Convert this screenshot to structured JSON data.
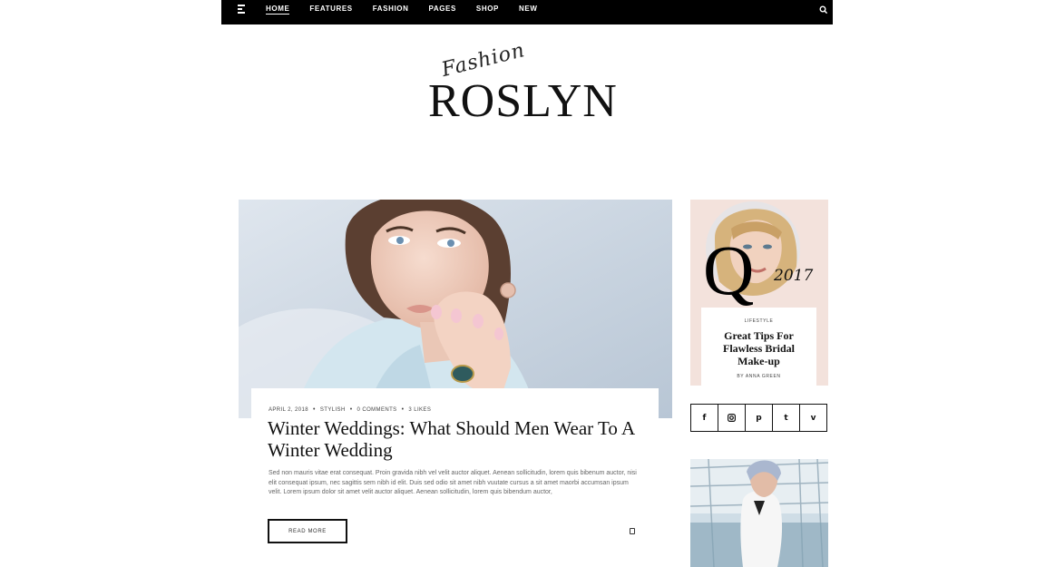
{
  "nav": {
    "items": [
      {
        "label": "HOME",
        "active": true
      },
      {
        "label": "FEATURES",
        "active": false
      },
      {
        "label": "FASHION",
        "active": false
      },
      {
        "label": "PAGES",
        "active": false
      },
      {
        "label": "SHOP",
        "active": false
      },
      {
        "label": "NEW",
        "active": false
      }
    ],
    "menu_icon": "hamburger-icon",
    "search_icon": "search-icon"
  },
  "logo": {
    "script": "Fashion",
    "main": "ROSLYN"
  },
  "feature": {
    "date": "APRIL 2, 2018",
    "category": "STYLISH",
    "comments": "0 COMMENTS",
    "likes": "3 LIKES",
    "title": "Winter Weddings: What Should Men Wear To A Winter Wedding",
    "excerpt": "Sed non mauris vitae erat consequat. Proin gravida nibh vel velit auctor aliquet. Aenean sollicitudin, lorem quis bibenum auctor, nisi elit consequat ipsum, nec sagittis sem nibh id elit. Duis sed odio sit amet nibh vuutate cursus a sit amet maorbi accumsan ipsum velit. Lorem ipsum dolor sit amet velit auctor aliquet. Aenean sollicitudin, lorem quis bibendum auctor,",
    "read_more": "READ MORE",
    "share_icon": "share-icon"
  },
  "promo": {
    "letter": "Q",
    "year": "2017",
    "category": "LIFESTYLE",
    "title": "Great Tips For Flawless Bridal Make-up",
    "author": "BY ANNA GREEN"
  },
  "social": [
    {
      "icon": "facebook-icon",
      "glyph": "f"
    },
    {
      "icon": "instagram-icon",
      "glyph": "◘"
    },
    {
      "icon": "pinterest-icon",
      "glyph": "p"
    },
    {
      "icon": "twitter-icon",
      "glyph": "t"
    },
    {
      "icon": "vimeo-icon",
      "glyph": "v"
    }
  ],
  "colors": {
    "nav_bg": "#000000",
    "promo_bg": "#f3e2dc",
    "text": "#111111"
  }
}
